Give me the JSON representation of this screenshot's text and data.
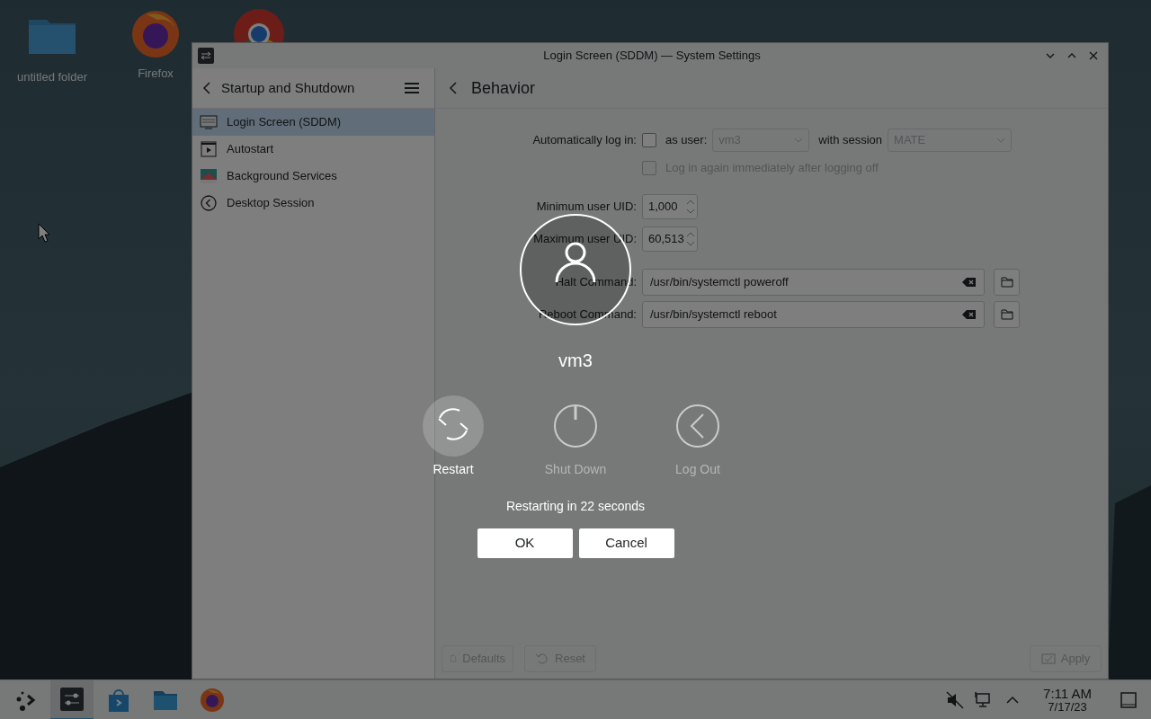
{
  "desktop_icons": [
    {
      "label": "untitled folder",
      "kind": "folder"
    },
    {
      "label": "Firefox",
      "kind": "firefox"
    },
    {
      "kind": "chrome"
    }
  ],
  "window": {
    "title": "Login Screen (SDDM) — System Settings",
    "sidebar": {
      "title": "Startup and Shutdown",
      "items": [
        {
          "label": "Login Screen (SDDM)",
          "selected": true,
          "kind": "screen"
        },
        {
          "label": "Autostart",
          "selected": false,
          "kind": "play"
        },
        {
          "label": "Background Services",
          "selected": false,
          "kind": "services"
        },
        {
          "label": "Desktop Session",
          "selected": false,
          "kind": "session"
        }
      ]
    },
    "page": {
      "title": "Behavior",
      "autologin": {
        "label": "Automatically log in:",
        "checked": false,
        "user_label": "as user:",
        "user": "vm3",
        "session_label": "with session",
        "session": "MATE",
        "relogin": {
          "label": "Log in again immediately after logging off",
          "checked": false
        }
      },
      "spin_fields": [
        {
          "label": "Minimum user UID:",
          "value": "1,000"
        },
        {
          "label": "Maximum user UID:",
          "value": "60,513"
        }
      ],
      "command_fields": [
        {
          "label": "Halt Command:",
          "value": "/usr/bin/systemctl poweroff"
        },
        {
          "label": "Reboot Command:",
          "value": "/usr/bin/systemctl reboot"
        }
      ],
      "footer_buttons": [
        {
          "label": "Defaults",
          "kind": "defaults",
          "disabled": true
        },
        {
          "label": "Reset",
          "kind": "reset",
          "disabled": true
        },
        {
          "label": "Apply",
          "kind": "apply",
          "disabled": true
        }
      ]
    }
  },
  "taskbar": {
    "apps": [
      {
        "kind": "launcher",
        "active": false
      },
      {
        "kind": "settings",
        "active": true
      },
      {
        "kind": "store",
        "active": false
      },
      {
        "kind": "files",
        "active": false
      },
      {
        "kind": "firefox",
        "active": false
      }
    ],
    "time": "7:11 AM",
    "date": "7/17/23"
  },
  "logout_dialog": {
    "user": "vm3",
    "actions": [
      {
        "label": "Restart",
        "kind": "restart",
        "selected": true
      },
      {
        "label": "Shut Down",
        "kind": "shutdown",
        "selected": false
      },
      {
        "label": "Log Out",
        "kind": "logout",
        "selected": false
      }
    ],
    "message": "Restarting in 22 seconds",
    "buttons": [
      "OK",
      "Cancel"
    ]
  }
}
